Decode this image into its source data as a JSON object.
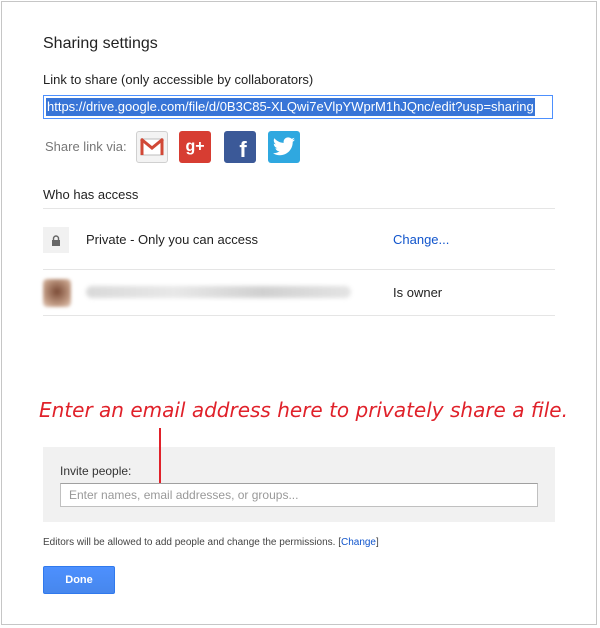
{
  "dialog": {
    "title": "Sharing settings",
    "link_label": "Link to share (only accessible by collaborators)",
    "link_url": "https://drive.google.com/file/d/0B3C85-XLQwi7eVlpYWprM1hJQnc/edit?usp=sharing",
    "share_via_label": "Share link via:",
    "social": [
      {
        "name": "gmail-icon",
        "color": "#d14836"
      },
      {
        "name": "google-plus-icon",
        "label": "g+",
        "color": "#d73d32"
      },
      {
        "name": "facebook-icon",
        "label": "f",
        "color": "#3b5998"
      },
      {
        "name": "twitter-icon",
        "color": "#2fa8e0"
      }
    ],
    "who_has_access_label": "Who has access",
    "access_rows": [
      {
        "icon": "lock-icon",
        "text": "Private - Only you can access",
        "action": "Change..."
      },
      {
        "icon": "avatar",
        "text": "",
        "role": "Is owner"
      }
    ],
    "annotation": "Enter an email address here to privately share a file.",
    "invite_label": "Invite people:",
    "invite_placeholder": "Enter names, email addresses, or groups...",
    "note_text": "Editors will be allowed to add people and change the permissions.",
    "note_link": "Change",
    "done_label": "Done"
  },
  "colors": {
    "accent": "#4d90fe",
    "link": "#1155cc",
    "annotation": "#e0212a"
  }
}
